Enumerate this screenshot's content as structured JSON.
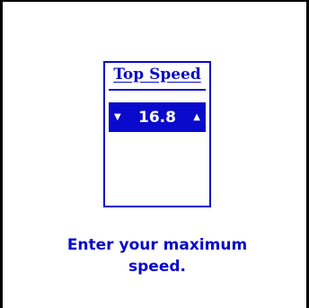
{
  "widget": {
    "title": "Top Speed",
    "value": "16.8",
    "decrement_icon": "triangle-down",
    "increment_icon": "triangle-up"
  },
  "instruction": {
    "line1": "Enter your maximum",
    "line2": "speed."
  },
  "colors": {
    "accent": "#0a0acc",
    "background": "#ffffff",
    "frame": "#000000"
  }
}
